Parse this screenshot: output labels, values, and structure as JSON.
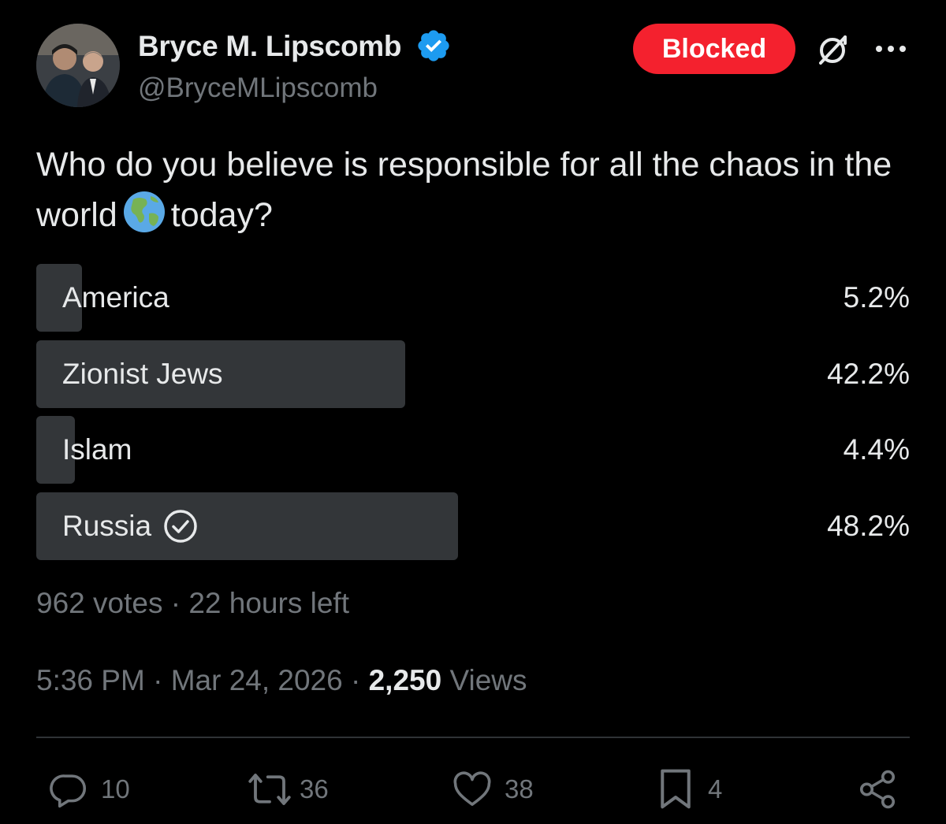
{
  "author": {
    "display_name": "Bryce M. Lipscomb",
    "handle": "@BryceMLipscomb",
    "verified": true
  },
  "header": {
    "blocked_label": "Blocked",
    "grok_icon": "grok-icon",
    "more_icon": "more-icon"
  },
  "tweet": {
    "text_before_emoji": "Who do you believe is responsible for all the chaos in the world",
    "emoji": "globe-americas-emoji",
    "text_after_emoji": "today?"
  },
  "poll": {
    "options": [
      {
        "label": "America",
        "percent_label": "5.2%",
        "percent": 5.2,
        "selected": false
      },
      {
        "label": "Zionist Jews",
        "percent_label": "42.2%",
        "percent": 42.2,
        "selected": false
      },
      {
        "label": "Islam",
        "percent_label": "4.4%",
        "percent": 4.4,
        "selected": false
      },
      {
        "label": "Russia",
        "percent_label": "48.2%",
        "percent": 48.2,
        "selected": true
      }
    ],
    "votes": "962 votes",
    "separator": "·",
    "time_left": "22 hours left"
  },
  "meta": {
    "time": "5:36 PM",
    "separator": "·",
    "date": "Mar 24, 2026",
    "views_count": "2,250",
    "views_label": "Views"
  },
  "actions": {
    "replies": "10",
    "reposts": "36",
    "likes": "38",
    "bookmarks": "4"
  },
  "colors": {
    "background": "#000000",
    "text": "#e7e9ea",
    "muted": "#71767b",
    "blocked": "#f4212e",
    "verified": "#1d9bf0",
    "poll_fill": "#333639"
  }
}
